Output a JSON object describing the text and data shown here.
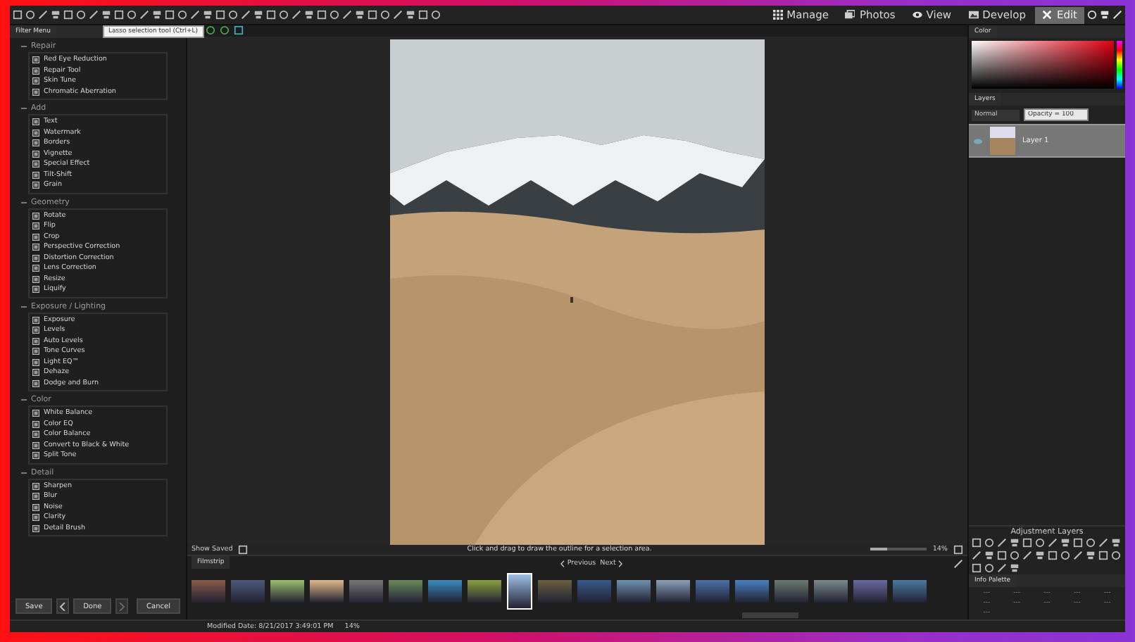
{
  "toolbar": {
    "tooltip": "Lasso selection tool (Ctrl+L)"
  },
  "modes": [
    {
      "label": "Manage",
      "kind": "grid",
      "selected": false
    },
    {
      "label": "Photos",
      "kind": "photos",
      "selected": false
    },
    {
      "label": "View",
      "kind": "eye",
      "selected": false
    },
    {
      "label": "Develop",
      "kind": "develop",
      "selected": false
    },
    {
      "label": "Edit",
      "kind": "edit",
      "selected": true
    }
  ],
  "filter_menu": {
    "title": "Filter Menu",
    "sections": [
      {
        "title": "Repair",
        "expanded": true,
        "items": [
          "Red Eye Reduction",
          "Repair Tool",
          "Skin Tune",
          "Chromatic Aberration"
        ]
      },
      {
        "title": "Add",
        "expanded": true,
        "items": [
          "Text",
          "Watermark",
          "Borders",
          "Vignette",
          "Special Effect",
          "Tilt-Shift",
          "Grain"
        ]
      },
      {
        "title": "Geometry",
        "expanded": true,
        "items": [
          "Rotate",
          "Flip",
          "Crop",
          "Perspective Correction",
          "Distortion Correction",
          "Lens Correction",
          "Resize",
          "Liquify"
        ]
      },
      {
        "title": "Exposure / Lighting",
        "expanded": true,
        "items": [
          "Exposure",
          "Levels",
          "Auto Levels",
          "Tone Curves",
          "Light EQ™",
          "Dehaze",
          "Dodge and Burn"
        ]
      },
      {
        "title": "Color",
        "expanded": true,
        "items": [
          "White Balance",
          "Color EQ",
          "Color Balance",
          "Convert to Black & White",
          "Split Tone"
        ]
      },
      {
        "title": "Detail",
        "expanded": true,
        "items": [
          "Sharpen",
          "Blur",
          "Noise",
          "Clarity",
          "Detail Brush"
        ]
      }
    ]
  },
  "actions": {
    "save": "Save",
    "done": "Done",
    "cancel": "Cancel"
  },
  "canvas": {
    "show_saved": "Show Saved",
    "hint": "Click and drag to draw the outline for a selection area.",
    "zoom": "14%",
    "zoom_slider": {
      "level": 0.3
    }
  },
  "filmstrip": {
    "title": "Filmstrip",
    "previous": "Previous",
    "next": "Next",
    "thumbnails": [
      {
        "selected": false
      },
      {
        "selected": false
      },
      {
        "selected": false
      },
      {
        "selected": false
      },
      {
        "selected": false
      },
      {
        "selected": false
      },
      {
        "selected": false
      },
      {
        "selected": false
      },
      {
        "selected": true
      },
      {
        "selected": false
      },
      {
        "selected": false
      },
      {
        "selected": false
      },
      {
        "selected": false
      },
      {
        "selected": false
      },
      {
        "selected": false
      },
      {
        "selected": false
      },
      {
        "selected": false
      },
      {
        "selected": false
      },
      {
        "selected": false
      }
    ]
  },
  "color_panel": {
    "title": "Color"
  },
  "layers": {
    "title": "Layers",
    "blend_mode": "Normal",
    "opacity": "Opacity = 100",
    "items": [
      {
        "name": "Layer 1",
        "selected": true,
        "visible": true
      }
    ]
  },
  "adjustment_layers": {
    "title": "Adjustment Layers"
  },
  "info_palette": {
    "title": "Info Palette",
    "values": [
      "---",
      "---",
      "---",
      "---",
      "---",
      "---",
      "---",
      "---",
      "---",
      "---",
      "---"
    ]
  },
  "status_bar": [
    "Modified Date: 8/21/2017 3:49:01 PM",
    "14%"
  ]
}
